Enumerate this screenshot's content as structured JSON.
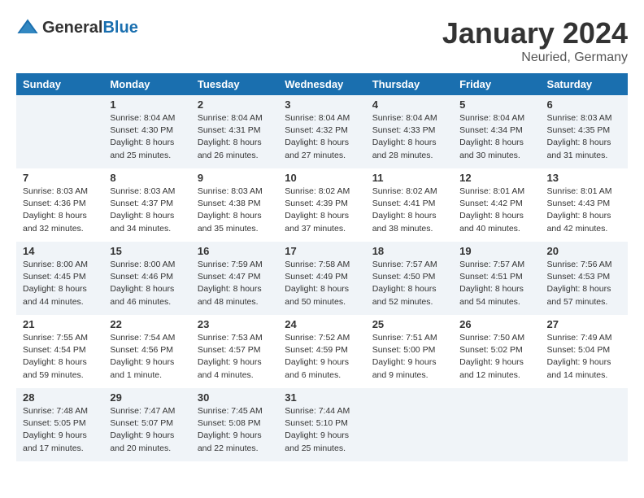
{
  "logo": {
    "text_general": "General",
    "text_blue": "Blue"
  },
  "title": "January 2024",
  "location": "Neuried, Germany",
  "weekdays": [
    "Sunday",
    "Monday",
    "Tuesday",
    "Wednesday",
    "Thursday",
    "Friday",
    "Saturday"
  ],
  "weeks": [
    [
      {
        "day": "",
        "info": ""
      },
      {
        "day": "1",
        "info": "Sunrise: 8:04 AM\nSunset: 4:30 PM\nDaylight: 8 hours\nand 25 minutes."
      },
      {
        "day": "2",
        "info": "Sunrise: 8:04 AM\nSunset: 4:31 PM\nDaylight: 8 hours\nand 26 minutes."
      },
      {
        "day": "3",
        "info": "Sunrise: 8:04 AM\nSunset: 4:32 PM\nDaylight: 8 hours\nand 27 minutes."
      },
      {
        "day": "4",
        "info": "Sunrise: 8:04 AM\nSunset: 4:33 PM\nDaylight: 8 hours\nand 28 minutes."
      },
      {
        "day": "5",
        "info": "Sunrise: 8:04 AM\nSunset: 4:34 PM\nDaylight: 8 hours\nand 30 minutes."
      },
      {
        "day": "6",
        "info": "Sunrise: 8:03 AM\nSunset: 4:35 PM\nDaylight: 8 hours\nand 31 minutes."
      }
    ],
    [
      {
        "day": "7",
        "info": "Sunrise: 8:03 AM\nSunset: 4:36 PM\nDaylight: 8 hours\nand 32 minutes."
      },
      {
        "day": "8",
        "info": "Sunrise: 8:03 AM\nSunset: 4:37 PM\nDaylight: 8 hours\nand 34 minutes."
      },
      {
        "day": "9",
        "info": "Sunrise: 8:03 AM\nSunset: 4:38 PM\nDaylight: 8 hours\nand 35 minutes."
      },
      {
        "day": "10",
        "info": "Sunrise: 8:02 AM\nSunset: 4:39 PM\nDaylight: 8 hours\nand 37 minutes."
      },
      {
        "day": "11",
        "info": "Sunrise: 8:02 AM\nSunset: 4:41 PM\nDaylight: 8 hours\nand 38 minutes."
      },
      {
        "day": "12",
        "info": "Sunrise: 8:01 AM\nSunset: 4:42 PM\nDaylight: 8 hours\nand 40 minutes."
      },
      {
        "day": "13",
        "info": "Sunrise: 8:01 AM\nSunset: 4:43 PM\nDaylight: 8 hours\nand 42 minutes."
      }
    ],
    [
      {
        "day": "14",
        "info": "Sunrise: 8:00 AM\nSunset: 4:45 PM\nDaylight: 8 hours\nand 44 minutes."
      },
      {
        "day": "15",
        "info": "Sunrise: 8:00 AM\nSunset: 4:46 PM\nDaylight: 8 hours\nand 46 minutes."
      },
      {
        "day": "16",
        "info": "Sunrise: 7:59 AM\nSunset: 4:47 PM\nDaylight: 8 hours\nand 48 minutes."
      },
      {
        "day": "17",
        "info": "Sunrise: 7:58 AM\nSunset: 4:49 PM\nDaylight: 8 hours\nand 50 minutes."
      },
      {
        "day": "18",
        "info": "Sunrise: 7:57 AM\nSunset: 4:50 PM\nDaylight: 8 hours\nand 52 minutes."
      },
      {
        "day": "19",
        "info": "Sunrise: 7:57 AM\nSunset: 4:51 PM\nDaylight: 8 hours\nand 54 minutes."
      },
      {
        "day": "20",
        "info": "Sunrise: 7:56 AM\nSunset: 4:53 PM\nDaylight: 8 hours\nand 57 minutes."
      }
    ],
    [
      {
        "day": "21",
        "info": "Sunrise: 7:55 AM\nSunset: 4:54 PM\nDaylight: 8 hours\nand 59 minutes."
      },
      {
        "day": "22",
        "info": "Sunrise: 7:54 AM\nSunset: 4:56 PM\nDaylight: 9 hours\nand 1 minute."
      },
      {
        "day": "23",
        "info": "Sunrise: 7:53 AM\nSunset: 4:57 PM\nDaylight: 9 hours\nand 4 minutes."
      },
      {
        "day": "24",
        "info": "Sunrise: 7:52 AM\nSunset: 4:59 PM\nDaylight: 9 hours\nand 6 minutes."
      },
      {
        "day": "25",
        "info": "Sunrise: 7:51 AM\nSunset: 5:00 PM\nDaylight: 9 hours\nand 9 minutes."
      },
      {
        "day": "26",
        "info": "Sunrise: 7:50 AM\nSunset: 5:02 PM\nDaylight: 9 hours\nand 12 minutes."
      },
      {
        "day": "27",
        "info": "Sunrise: 7:49 AM\nSunset: 5:04 PM\nDaylight: 9 hours\nand 14 minutes."
      }
    ],
    [
      {
        "day": "28",
        "info": "Sunrise: 7:48 AM\nSunset: 5:05 PM\nDaylight: 9 hours\nand 17 minutes."
      },
      {
        "day": "29",
        "info": "Sunrise: 7:47 AM\nSunset: 5:07 PM\nDaylight: 9 hours\nand 20 minutes."
      },
      {
        "day": "30",
        "info": "Sunrise: 7:45 AM\nSunset: 5:08 PM\nDaylight: 9 hours\nand 22 minutes."
      },
      {
        "day": "31",
        "info": "Sunrise: 7:44 AM\nSunset: 5:10 PM\nDaylight: 9 hours\nand 25 minutes."
      },
      {
        "day": "",
        "info": ""
      },
      {
        "day": "",
        "info": ""
      },
      {
        "day": "",
        "info": ""
      }
    ]
  ]
}
